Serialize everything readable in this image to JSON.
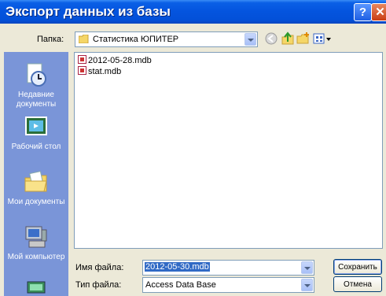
{
  "window": {
    "title": "Экспорт данных из базы",
    "help_label": "?",
    "close_label": "✕"
  },
  "toolbar": {
    "folder_label": "Папка:",
    "folder_value": "Статистика ЮПИТЕР",
    "icons": [
      "back-icon",
      "up-folder-icon",
      "new-folder-icon",
      "view-menu-icon"
    ]
  },
  "places": [
    {
      "label": "Недавние документы",
      "icon": "recent-documents-icon"
    },
    {
      "label": "Рабочий стол",
      "icon": "desktop-icon"
    },
    {
      "label": "Мои документы",
      "icon": "my-documents-icon"
    },
    {
      "label": "Мой компьютер",
      "icon": "my-computer-icon"
    },
    {
      "label": "",
      "icon": "network-icon"
    }
  ],
  "files": [
    {
      "name": "2012-05-28.mdb",
      "icon": "access-db-icon"
    },
    {
      "name": "stat.mdb",
      "icon": "access-db-icon"
    }
  ],
  "form": {
    "filename_label": "Имя файла:",
    "filename_value": "2012-05-30.mdb",
    "filetype_label": "Тип файла:",
    "filetype_value": "Access Data Base"
  },
  "buttons": {
    "save": "Сохранить",
    "cancel": "Отмена"
  }
}
